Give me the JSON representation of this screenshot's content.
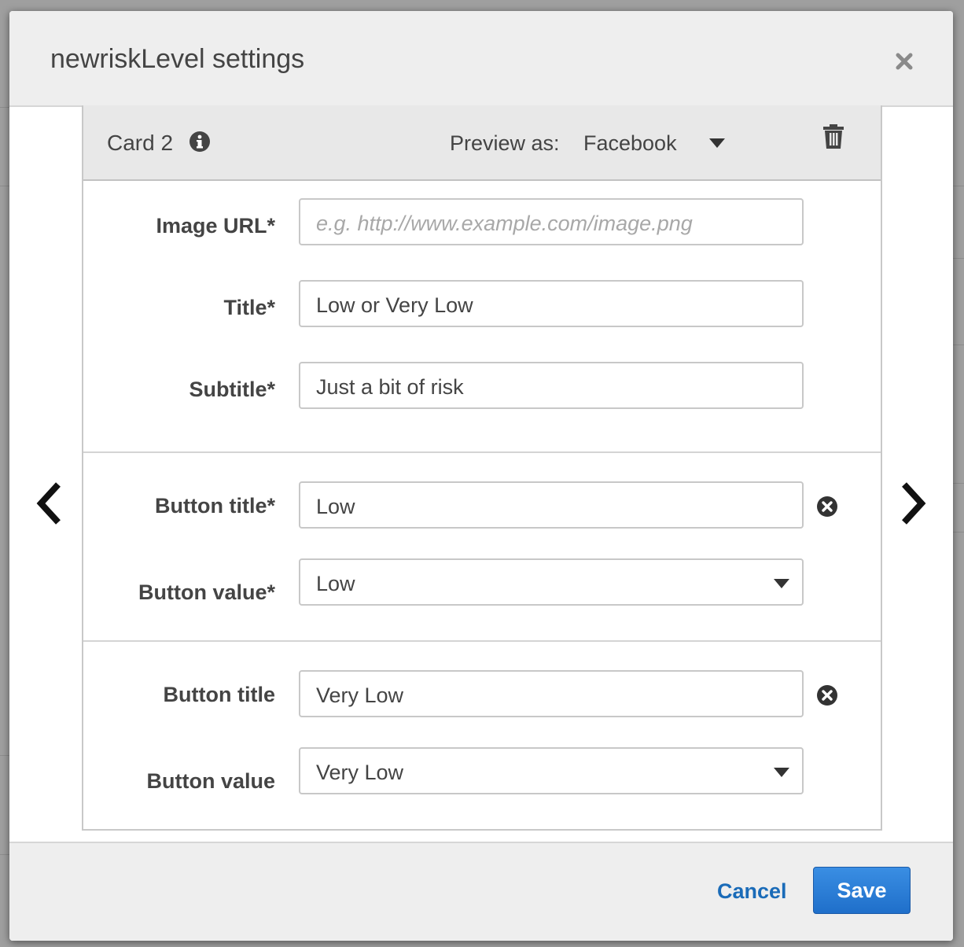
{
  "modal": {
    "title": "newriskLevel settings"
  },
  "card": {
    "label": "Card 2",
    "preview_label": "Preview as:",
    "preview_value": "Facebook"
  },
  "fields": {
    "image_url": {
      "label": "Image URL*",
      "value": "",
      "placeholder": "e.g. http://www.example.com/image.png"
    },
    "title": {
      "label": "Title*",
      "value": "Low or Very Low"
    },
    "subtitle": {
      "label": "Subtitle*",
      "value": "Just a bit of risk"
    }
  },
  "buttons": [
    {
      "title_label": "Button title*",
      "title_value": "Low",
      "value_label": "Button value*",
      "value_selected": "Low"
    },
    {
      "title_label": "Button title",
      "title_value": "Very Low",
      "value_label": "Button value",
      "value_selected": "Very Low"
    }
  ],
  "footer": {
    "cancel_label": "Cancel",
    "save_label": "Save"
  },
  "icons": {
    "close": "close-icon",
    "info": "info-icon",
    "trash": "trash-icon",
    "prev": "chevron-left-icon",
    "next": "chevron-right-icon",
    "remove": "remove-circle-icon",
    "caret": "caret-down-icon"
  },
  "colors": {
    "accent": "#1f6fca",
    "link": "#1a6bb8",
    "header_bg": "#eeeeee"
  }
}
